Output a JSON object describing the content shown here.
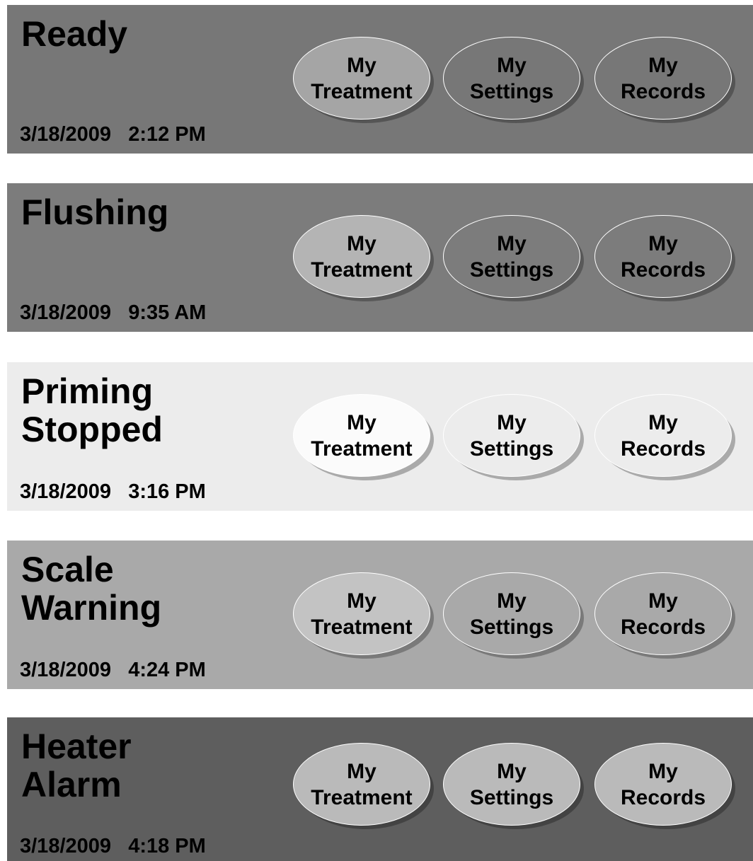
{
  "panels": [
    {
      "title_lines": [
        "Ready",
        ""
      ],
      "date": "3/18/2009",
      "time": "2:12 PM",
      "colors": {
        "background": "#777777",
        "active_button": "#a5a5a5",
        "button": "#777777"
      },
      "buttons": [
        {
          "line1": "My",
          "line2": "Treatment"
        },
        {
          "line1": "My",
          "line2": "Settings"
        },
        {
          "line1": "My",
          "line2": "Records"
        }
      ]
    },
    {
      "title_lines": [
        "Flushing",
        ""
      ],
      "date": "3/18/2009",
      "time": "9:35 AM",
      "colors": {
        "background": "#7c7c7c",
        "active_button": "#b4b4b4",
        "button": "#7c7c7c"
      },
      "buttons": [
        {
          "line1": "My",
          "line2": "Treatment"
        },
        {
          "line1": "My",
          "line2": "Settings"
        },
        {
          "line1": "My",
          "line2": "Records"
        }
      ]
    },
    {
      "title_lines": [
        "Priming",
        "Stopped"
      ],
      "date": "3/18/2009",
      "time": "3:16 PM",
      "colors": {
        "background": "#ececec",
        "active_button": "#fbfbfb",
        "button": "#ececec"
      },
      "buttons": [
        {
          "line1": "My",
          "line2": "Treatment"
        },
        {
          "line1": "My",
          "line2": "Settings"
        },
        {
          "line1": "My",
          "line2": "Records"
        }
      ]
    },
    {
      "title_lines": [
        "Scale",
        "Warning"
      ],
      "date": "3/18/2009",
      "time": "4:24 PM",
      "colors": {
        "background": "#a9a9a9",
        "active_button": "#c3c3c3",
        "button": "#a9a9a9"
      },
      "buttons": [
        {
          "line1": "My",
          "line2": "Treatment"
        },
        {
          "line1": "My",
          "line2": "Settings"
        },
        {
          "line1": "My",
          "line2": "Records"
        }
      ]
    },
    {
      "title_lines": [
        "Heater",
        "Alarm"
      ],
      "date": "3/18/2009",
      "time": "4:18 PM",
      "colors": {
        "background": "#5e5e5e",
        "active_button": "#bababa",
        "button": "#bababa"
      },
      "buttons": [
        {
          "line1": "My",
          "line2": "Treatment"
        },
        {
          "line1": "My",
          "line2": "Settings"
        },
        {
          "line1": "My",
          "line2": "Records"
        }
      ]
    }
  ]
}
